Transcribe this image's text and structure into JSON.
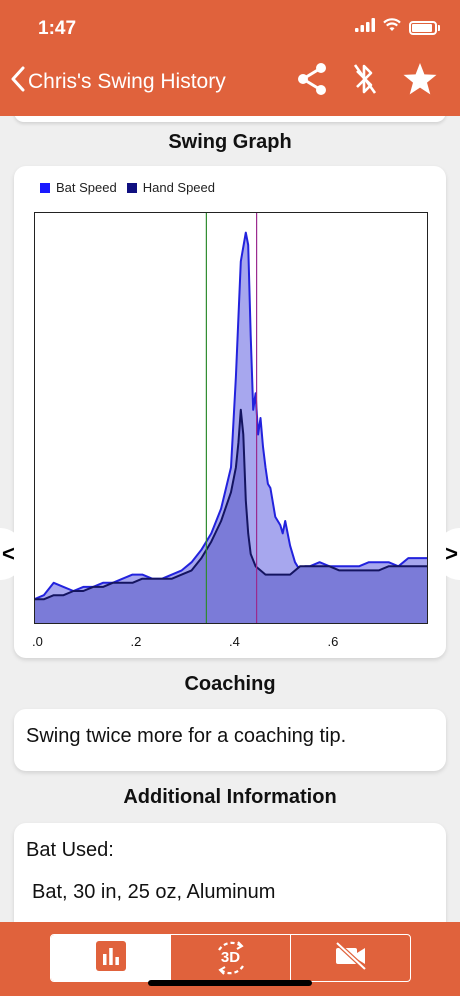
{
  "status": {
    "time": "1:47"
  },
  "nav": {
    "title": "Chris's Swing History"
  },
  "graph": {
    "title": "Swing Graph",
    "legend": [
      {
        "label": "Bat Speed",
        "color": "#1a1aff"
      },
      {
        "label": "Hand Speed",
        "color": "#101080"
      }
    ],
    "prev_label": "<",
    "next_label": ">"
  },
  "chart_data": {
    "type": "area",
    "xlim": [
      0,
      0.8
    ],
    "x_tick_labels": [
      ".0",
      ".2",
      ".4",
      ".6"
    ],
    "x_ticks": [
      0,
      0.2,
      0.4,
      0.6
    ],
    "ylim": [
      0,
      100
    ],
    "markers": [
      {
        "x": 0.35,
        "color": "#2e8b2e"
      },
      {
        "x": 0.452,
        "color": "#9b2a8e"
      }
    ],
    "series": [
      {
        "name": "Bat Speed",
        "color": "#2222dd",
        "fill": "#a7a7ee",
        "x": [
          0,
          0.02,
          0.04,
          0.06,
          0.08,
          0.1,
          0.12,
          0.14,
          0.16,
          0.18,
          0.2,
          0.22,
          0.24,
          0.26,
          0.28,
          0.3,
          0.32,
          0.34,
          0.36,
          0.38,
          0.4,
          0.41,
          0.42,
          0.43,
          0.435,
          0.44,
          0.445,
          0.45,
          0.455,
          0.46,
          0.465,
          0.47,
          0.475,
          0.48,
          0.49,
          0.5,
          0.505,
          0.51,
          0.52,
          0.53,
          0.54,
          0.55,
          0.56,
          0.58,
          0.6,
          0.62,
          0.64,
          0.66,
          0.68,
          0.7,
          0.72,
          0.74,
          0.76,
          0.78,
          0.8
        ],
        "y": [
          6,
          7,
          10,
          9,
          8,
          9,
          9,
          10,
          10,
          11,
          12,
          12,
          11,
          11,
          12,
          13,
          15,
          18,
          22,
          28,
          38,
          60,
          88,
          95,
          92,
          70,
          52,
          56,
          46,
          50,
          43,
          38,
          34,
          33,
          26,
          24,
          22,
          25,
          19,
          15,
          13,
          14,
          14,
          15,
          14,
          14,
          14,
          14,
          15,
          15,
          15,
          14,
          16,
          16,
          16
        ]
      },
      {
        "name": "Hand Speed",
        "color": "#141460",
        "fill": "#7b7bd8",
        "x": [
          0,
          0.02,
          0.04,
          0.06,
          0.08,
          0.1,
          0.12,
          0.14,
          0.16,
          0.18,
          0.2,
          0.22,
          0.24,
          0.26,
          0.28,
          0.3,
          0.32,
          0.34,
          0.36,
          0.38,
          0.4,
          0.41,
          0.415,
          0.42,
          0.425,
          0.43,
          0.435,
          0.44,
          0.45,
          0.46,
          0.47,
          0.48,
          0.5,
          0.52,
          0.54,
          0.56,
          0.58,
          0.6,
          0.62,
          0.64,
          0.66,
          0.68,
          0.7,
          0.72,
          0.74,
          0.76,
          0.78,
          0.8
        ],
        "y": [
          6,
          6,
          7,
          7,
          8,
          8,
          9,
          9,
          10,
          10,
          10,
          11,
          11,
          11,
          11,
          12,
          13,
          16,
          20,
          25,
          32,
          38,
          44,
          52,
          46,
          30,
          22,
          17,
          14,
          13,
          12,
          12,
          12,
          12,
          14,
          14,
          14,
          14,
          13,
          13,
          13,
          13,
          13,
          14,
          14,
          14,
          14,
          14
        ]
      }
    ]
  },
  "coaching": {
    "title": "Coaching",
    "message": "Swing twice more for a coaching tip."
  },
  "additional": {
    "title": "Additional Information",
    "bat_label": "Bat Used:",
    "bat_value": "Bat, 30 in, 25 oz, Aluminum"
  },
  "tabs": {
    "three_d_label": "3D"
  }
}
